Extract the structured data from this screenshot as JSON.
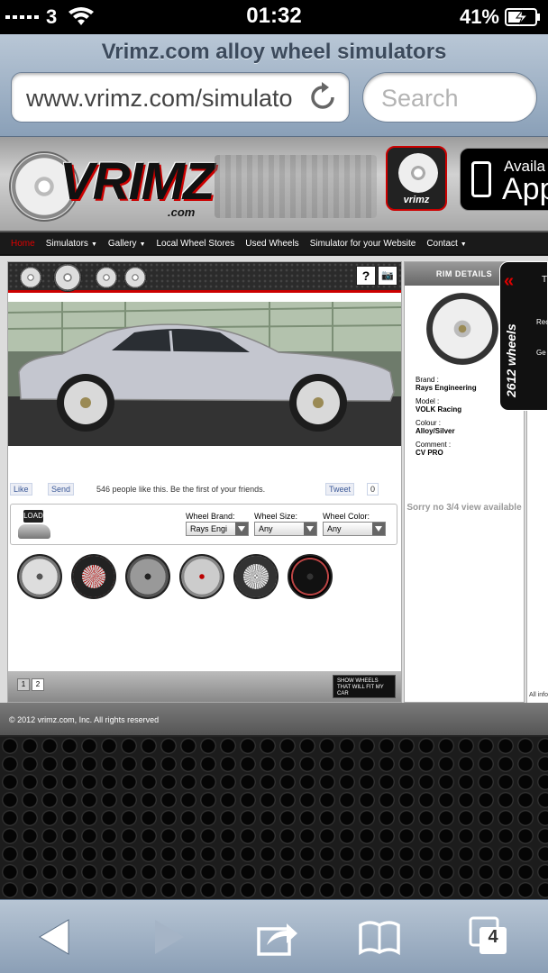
{
  "status_bar": {
    "carrier": "3",
    "time": "01:32",
    "battery": "41%"
  },
  "browser": {
    "page_title": "Vrimz.com alloy wheel simulators",
    "url": "www.vrimz.com/simulato",
    "search_placeholder": "Search",
    "tabs_count": "4"
  },
  "site": {
    "logo_text": "VRIMZ",
    "logo_sub": ".com",
    "app_icon_label": "vrimz",
    "app_badge_line1": "Availa",
    "app_badge_line2": "App",
    "nav": [
      {
        "label": "Home",
        "active": true,
        "dropdown": false
      },
      {
        "label": "Simulators",
        "dropdown": true
      },
      {
        "label": "Gallery",
        "dropdown": true
      },
      {
        "label": "Local Wheel Stores",
        "dropdown": false
      },
      {
        "label": "Used Wheels",
        "dropdown": false
      },
      {
        "label": "Simulator for your Website",
        "dropdown": false
      },
      {
        "label": "Contact",
        "dropdown": true
      }
    ],
    "strip_buttons": [
      "?",
      "📷"
    ],
    "facebook": {
      "like": "Like",
      "send": "Send",
      "text": "546 people like this. Be the first of your friends.",
      "tweet": "Tweet",
      "tweet_count": "0"
    },
    "load_label": "LOAD",
    "filters": [
      {
        "label": "Wheel Brand:",
        "value": "Rays Engi"
      },
      {
        "label": "Wheel Size:",
        "value": "Any"
      },
      {
        "label": "Wheel Color:",
        "value": "Any"
      }
    ],
    "pages": [
      "1",
      "2"
    ],
    "show_wheels_label": "SHOW WHEELS THAT WILL FIT MY CAR",
    "rim_details": {
      "header": "RIM DETAILS",
      "brand_label": "Brand :",
      "brand": "Rays Engineering",
      "model_label": "Model :",
      "model": "VOLK Racing",
      "colour_label": "Colour :",
      "colour": "Alloy/Silver",
      "comment_label": "Comment :",
      "comment": "CV PRO",
      "sorry": "Sorry no 3/4 view available"
    },
    "side_tab": {
      "chevron": "«",
      "text": "2612 wheels",
      "t1": "T",
      "t2": "Rec",
      "t3": "Ge"
    },
    "right_col_note": "All info",
    "footer": "© 2012 vrimz.com, Inc. All rights reserved"
  },
  "colors": {
    "accent_red": "#cc0000",
    "nav_bg": "#1a1a1a",
    "safari_bar": "#9fb2c6"
  }
}
